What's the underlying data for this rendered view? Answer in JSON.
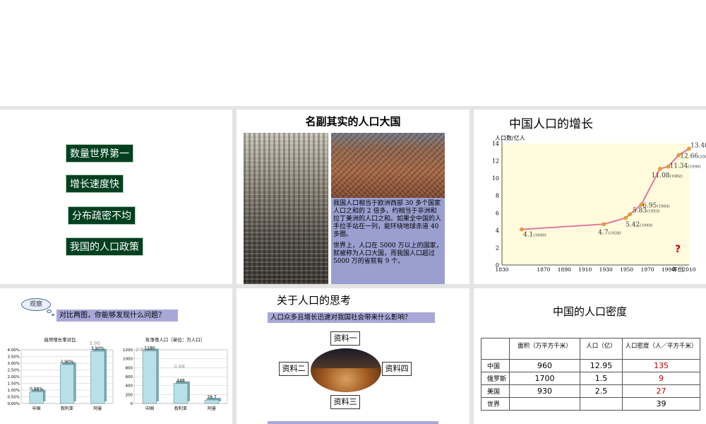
{
  "slide1": {
    "items": [
      "数量世界第一",
      "增长速度快",
      "分布疏密不均",
      "我国的人口政策"
    ]
  },
  "slide2": {
    "title": "名副其实的人口大国",
    "para1": "我国人口相当于欧洲西部 30 多个国家人口之和的 2 倍多，约相当于非洲和拉丁美洲的人口之和。如果全中国的人手拉手站在一列，能环绕地球赤道 40 多圈。",
    "para2": "世界上，人口在 5000 万以上的国家，就被称为人口大国，而我国人口超过 5000 万的省就有 9 个。"
  },
  "slide3": {
    "title": "中国人口的增长",
    "qmark": "?",
    "chart_data": {
      "type": "line",
      "ylabel": "人口数/亿人",
      "xlabel": "年份",
      "xlim": [
        1830,
        2010
      ],
      "ylim": [
        0,
        14
      ],
      "xticks": [
        1830,
        1870,
        1890,
        1910,
        1930,
        1950,
        1970,
        1990,
        2010
      ],
      "yticks": [
        0,
        2,
        4,
        6,
        8,
        10,
        12,
        14
      ],
      "points": [
        {
          "x": 1849,
          "y": 4.1,
          "label": "4.1",
          "year_label": "(1849)"
        },
        {
          "x": 1928,
          "y": 4.7,
          "label": "4.7",
          "year_label": "(1928)"
        },
        {
          "x": 1949,
          "y": 5.42,
          "label": "5.42",
          "year_label": "(1949)"
        },
        {
          "x": 1953,
          "y": 5.83,
          "label": "5.83",
          "year_label": "(1953)"
        },
        {
          "x": 1964,
          "y": 6.95,
          "label": "6.95",
          "year_label": "(1964)"
        },
        {
          "x": 1982,
          "y": 11.08,
          "label": "11.08",
          "year_label": "(1982)"
        },
        {
          "x": 1990,
          "y": 11.34,
          "label": "11.34",
          "year_label": "(1990)"
        },
        {
          "x": 2000,
          "y": 12.66,
          "label": "12.66",
          "year_label": "(2000)"
        },
        {
          "x": 2010,
          "y": 13.4,
          "label": "13.40",
          "year_label": "(2010)"
        }
      ]
    }
  },
  "slide4": {
    "cloud": "观察",
    "question": "对比两图，你能够发现什么问题？",
    "chart_data": [
      {
        "type": "bar",
        "title": "自然增长率对比",
        "categories": [
          "中国",
          "叙利亚",
          "阿曼"
        ],
        "values": [
          0.88,
          2.9,
          3.9
        ],
        "value_labels": [
          "0.88%",
          "2.90%",
          "3.90%"
        ],
        "yticks": [
          "0.00%",
          "0.50%",
          "1.00%",
          "1.50%",
          "2.00%",
          "2.50%",
          "3.00%",
          "3.50%",
          "4.00%"
        ],
        "ylim": [
          0,
          4
        ],
        "annotation": "3.90"
      },
      {
        "type": "bar",
        "title": "年净增人口（单位：万人口）",
        "categories": [
          "中国",
          "叙利亚",
          "阿曼"
        ],
        "values": [
          1180,
          448,
          78.7
        ],
        "value_labels": [
          "1180",
          "448",
          "78.7"
        ],
        "yticks": [
          "0",
          "200",
          "400",
          "600",
          "800",
          "1000",
          "1200"
        ],
        "ylim": [
          0,
          1200
        ],
        "annotations": [
          "2.90",
          "0.88"
        ]
      }
    ]
  },
  "slide5": {
    "title": "关于人口的思考",
    "question": "人口众多且增长迅速对我国社会带来什么影响？",
    "boxes": [
      "资料一",
      "资料二",
      "资料四",
      "资料三"
    ]
  },
  "slide6": {
    "title": "中国的人口密度",
    "table": {
      "headers": [
        "",
        "面积（万平方千米）",
        "人口（亿）",
        "人口密度（人／平方千米）"
      ],
      "rows": [
        {
          "name": "中国",
          "area": "960",
          "pop": "12.95",
          "density": "135"
        },
        {
          "name": "俄罗斯",
          "area": "1700",
          "pop": "1.5",
          "density": "9"
        },
        {
          "name": "美国",
          "area": "930",
          "pop": "2.5",
          "density": "27"
        },
        {
          "name": "世界",
          "area": "",
          "pop": "",
          "density": "39"
        }
      ]
    }
  }
}
